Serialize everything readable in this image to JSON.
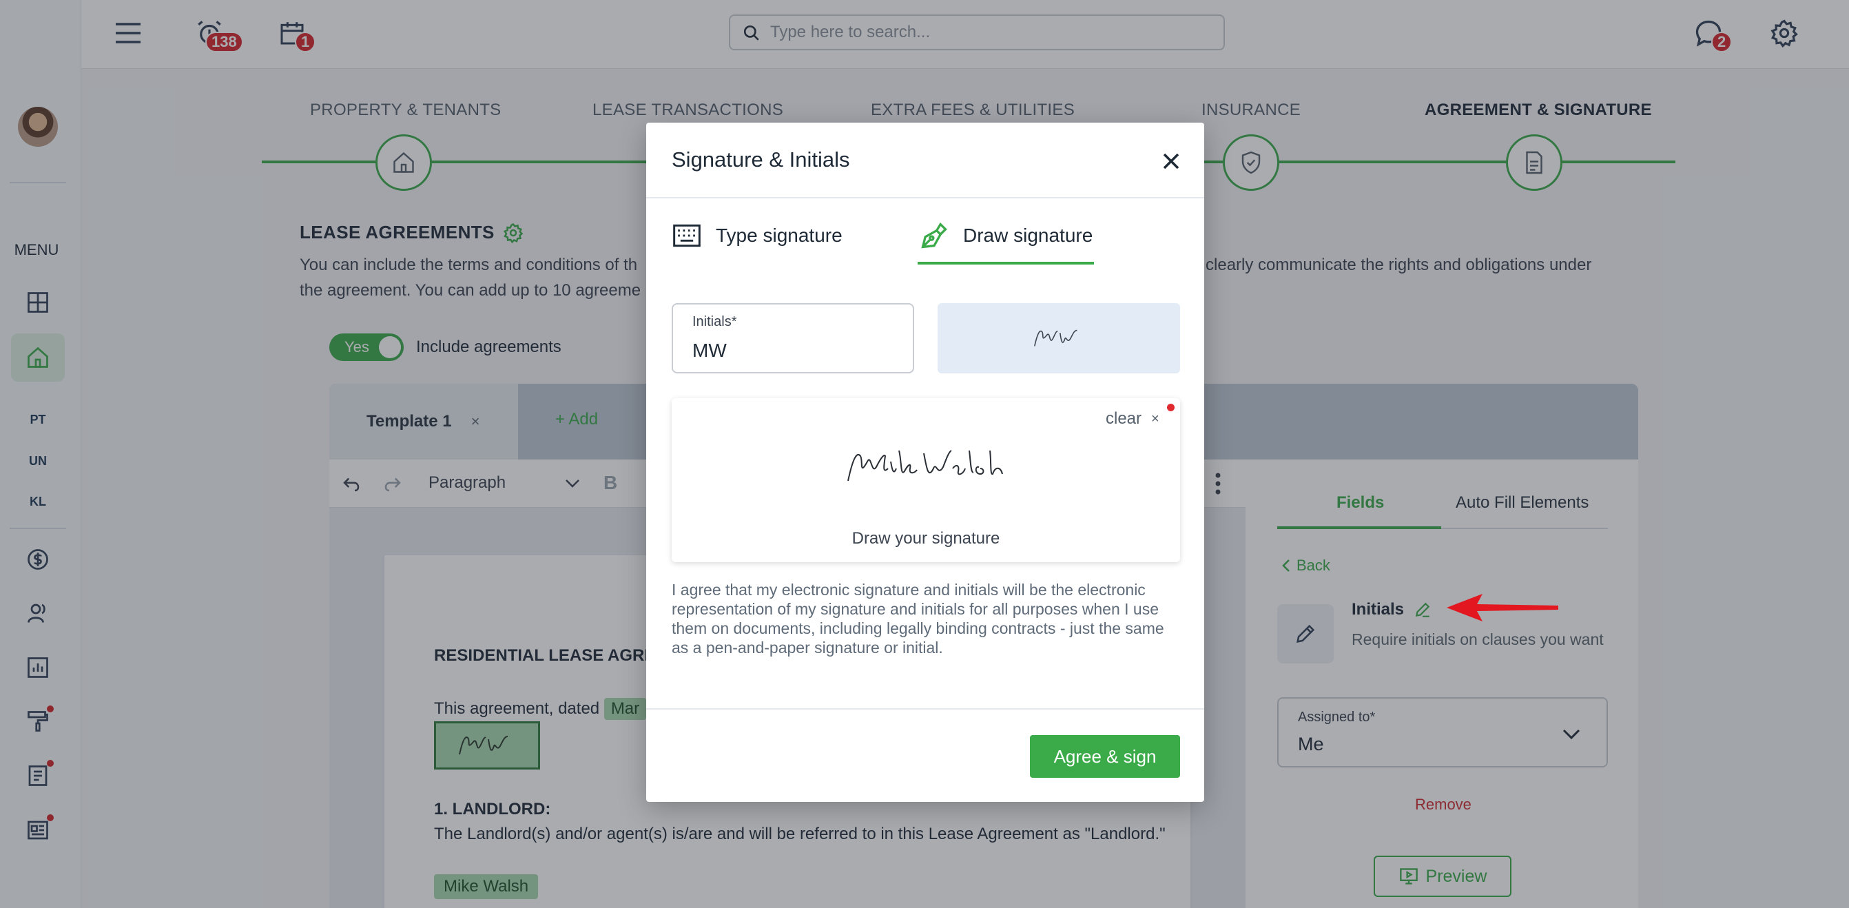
{
  "topbar": {
    "search_placeholder": "Type here to search...",
    "alarm_badge": "138",
    "calendar_badge": "1",
    "chat_badge": "2"
  },
  "sidebar": {
    "menu_label": "MENU",
    "short_items": [
      "PT",
      "UN",
      "KL"
    ]
  },
  "stepper": {
    "steps": [
      "PROPERTY & TENANTS",
      "LEASE TRANSACTIONS",
      "EXTRA FEES & UTILITIES",
      "INSURANCE",
      "AGREEMENT & SIGNATURE"
    ]
  },
  "lease": {
    "title": "LEASE AGREEMENTS",
    "description": "You can include the terms and conditions of th… d clearly communicate the rights and obligations under the agreement. You can add up to 10 agreeme…",
    "desc_line1_left": "You can include the terms and conditions of th",
    "desc_line1_right": "d clearly communicate the rights and obligations under",
    "desc_line2": "the agreement. You can add up to 10 agreeme",
    "toggle_label": "Yes",
    "include_label": "Include agreements",
    "template_tab": "Template 1",
    "template_close": "×",
    "add_tab": "+ Add"
  },
  "editor": {
    "paragraph_select": "Paragraph",
    "bold": "B",
    "doc_heading": "RESIDENTIAL LEASE AGRE",
    "dated_text": "This agreement, dated",
    "dated_chip": "Mar",
    "initials_box": "MW",
    "landlord_heading": "1. LANDLORD:",
    "landlord_text": "The Landlord(s) and/or agent(s) is/are and will be referred to in this Lease Agreement as \"Landlord.\"",
    "name_chip": "Mike Walsh"
  },
  "right_panel": {
    "tab_fields": "Fields",
    "tab_auto": "Auto Fill Elements",
    "back": "Back",
    "field_title": "Initials",
    "field_desc": "Require initials on clauses you want",
    "assigned_label": "Assigned to*",
    "assigned_value": "Me",
    "remove": "Remove",
    "preview": "Preview"
  },
  "modal": {
    "title": "Signature & Initials",
    "tab_type": "Type signature",
    "tab_draw": "Draw signature",
    "initials_label": "Initials*",
    "initials_value": "MW",
    "initials_preview": "MW",
    "clear": "clear",
    "clear_x": "×",
    "drawn_signature": "Mike Walsh",
    "draw_hint": "Draw your signature",
    "agree_text": "I agree that my electronic signature and initials will be the electronic representation of my signature and initials for all purposes when I use them on documents, including legally binding contracts - just the same as a pen-and-paper signature or initial.",
    "agree_button": "Agree & sign"
  },
  "colors": {
    "accent_green": "#3bab4a",
    "badge_red": "#d8262c",
    "annotation_arrow": "#e3171f"
  }
}
